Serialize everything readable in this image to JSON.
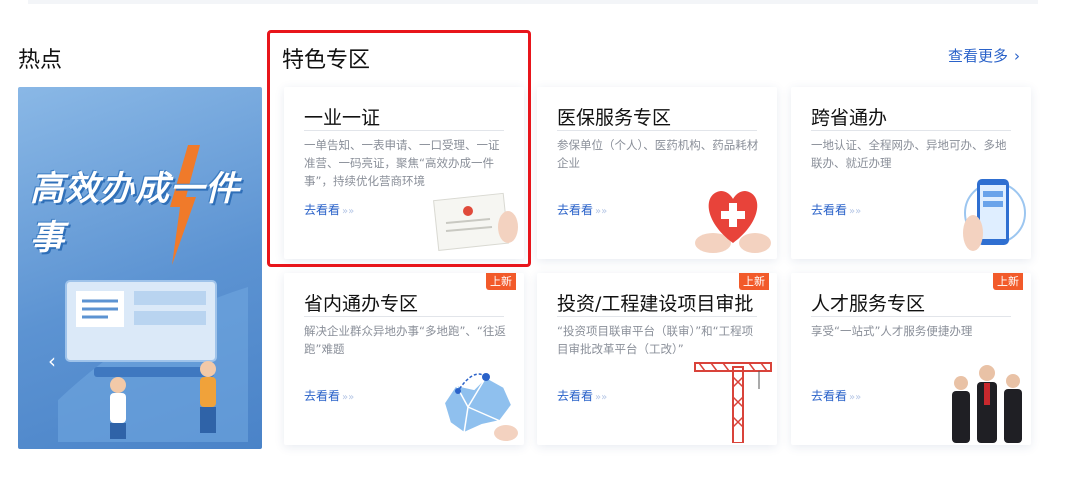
{
  "hot": {
    "title": "热点",
    "banner_text": "高效办成一件事"
  },
  "special": {
    "title": "特色专区",
    "more_label": "查看更多"
  },
  "cards": [
    {
      "title": "一业一证",
      "desc": "一单告知、一表申请、一口受理、一证准营、一码亮证，聚焦“高效办成一件事”，持续优化营商环境",
      "link": "去看看",
      "badge": ""
    },
    {
      "title": "医保服务专区",
      "desc": "参保单位（个人）、医药机构、药品耗材企业",
      "link": "去看看",
      "badge": ""
    },
    {
      "title": "跨省通办",
      "desc": "一地认证、全程网办、异地可办、多地联办、就近办理",
      "link": "去看看",
      "badge": ""
    },
    {
      "title": "省内通办专区",
      "desc": "解决企业群众异地办事“多地跑”、“往返跑”难题",
      "link": "去看看",
      "badge": "上新"
    },
    {
      "title": "投资/工程建设项目审批",
      "desc": "“投资项目联审平台（联审）”和“工程项目审批改革平台（工改）”",
      "link": "去看看",
      "badge": "上新"
    },
    {
      "title": "人才服务专区",
      "desc": "享受“一站式”人才服务便捷办理",
      "link": "去看看",
      "badge": "上新"
    }
  ],
  "colors": {
    "accent": "#2a62c9",
    "badge": "#f25a2a",
    "highlight": "#e8151b",
    "banner": "#5c93d2"
  }
}
